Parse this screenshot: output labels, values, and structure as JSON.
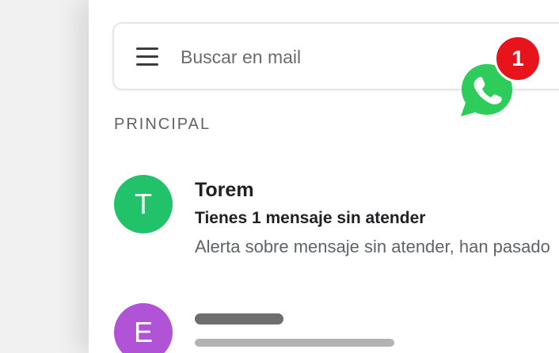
{
  "search": {
    "placeholder": "Buscar en mail",
    "menu_icon": "hamburger-menu-icon"
  },
  "notification": {
    "app_icon": "whatsapp-icon",
    "count": "1",
    "badge_color": "#e8141c",
    "icon_color": "#2ecc5a"
  },
  "inbox": {
    "section_label": "PRINCIPAL",
    "emails": [
      {
        "avatar_letter": "T",
        "avatar_color": "#22c26a",
        "sender": "Torem",
        "subject": "Tienes 1 mensaje sin atender",
        "snippet": "Alerta sobre mensaje sin atender, han pasado"
      },
      {
        "avatar_letter": "E",
        "avatar_color": "#b053d6",
        "sender": "",
        "subject": "",
        "snippet": ""
      }
    ]
  }
}
